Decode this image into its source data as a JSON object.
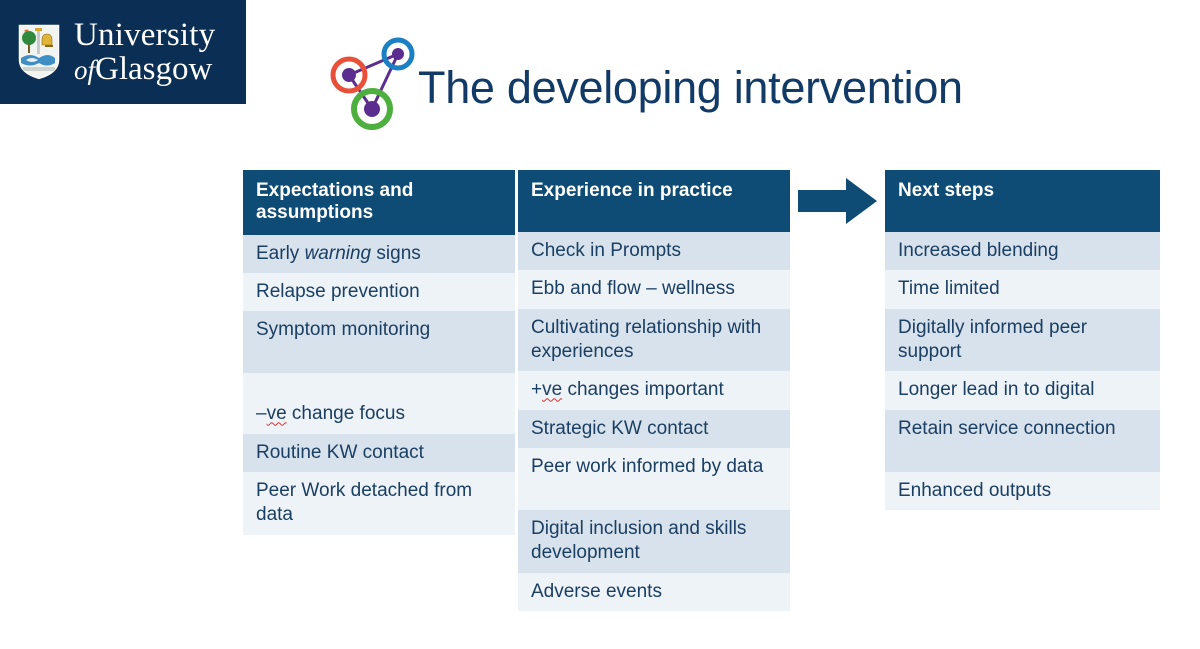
{
  "brand": {
    "logo_line1": "University",
    "logo_of": "of",
    "logo_line2": "Glasgow",
    "crest_icon": "glasgow-coat-of-arms-crest",
    "background_color": "#0a2e54"
  },
  "header": {
    "title": "The developing intervention",
    "title_color": "#123a66",
    "icon": "network-nodes-icon",
    "icon_node_colors": [
      "#e8503a",
      "#1b7fc4",
      "#4caf3e"
    ],
    "icon_center_color": "#5b2d8e",
    "icon_edge_color": "#5b2d8e"
  },
  "flow_arrow": {
    "icon": "arrow-right-icon",
    "color": "#0e4c75"
  },
  "table": {
    "header_bg": "#0e4c75",
    "header_text_color": "#ffffff",
    "row_shade_a": "#d7e2ec",
    "row_shade_b": "#eef3f8",
    "cell_text_color": "#1b3f63",
    "columns": [
      {
        "header": "Expectations and assumptions",
        "rows": [
          {
            "text": "Early warning signs",
            "italic_word": "warning",
            "shade": "a",
            "tall": false
          },
          {
            "text": "Relapse prevention",
            "shade": "b",
            "tall": false
          },
          {
            "text": "Symptom monitoring",
            "shade": "a",
            "tall": true
          },
          {
            "text": "",
            "shade": "b",
            "tall": false,
            "empty": true
          },
          {
            "text": "–ve change focus",
            "misspelled": "ve",
            "shade": "b",
            "tall": false
          },
          {
            "text": "Routine KW contact",
            "shade": "a",
            "tall": false
          },
          {
            "text": "Peer Work detached from data",
            "shade": "b",
            "tall": true
          }
        ]
      },
      {
        "header": "Experience in practice",
        "rows": [
          {
            "text": "Check in Prompts",
            "shade": "a",
            "tall": false
          },
          {
            "text": "Ebb and flow – wellness",
            "shade": "b",
            "tall": false
          },
          {
            "text": "Cultivating relationship with experiences",
            "shade": "a",
            "tall": true
          },
          {
            "text": "+ve changes important",
            "misspelled": "ve",
            "shade": "b",
            "tall": false
          },
          {
            "text": "Strategic KW contact",
            "shade": "a",
            "tall": false
          },
          {
            "text": "Peer work informed by data",
            "shade": "b",
            "tall": true
          },
          {
            "text": "Digital inclusion and skills development",
            "shade": "a",
            "tall": true
          },
          {
            "text": "Adverse events",
            "shade": "b",
            "tall": false
          }
        ]
      },
      {
        "header": "Next steps",
        "rows": [
          {
            "text": "Increased blending",
            "shade": "a",
            "tall": false
          },
          {
            "text": "Time limited",
            "shade": "b",
            "tall": false
          },
          {
            "text": "Digitally informed peer support",
            "shade": "a",
            "tall": true
          },
          {
            "text": "Longer lead in to digital",
            "shade": "b",
            "tall": false
          },
          {
            "text": "Retain service connection",
            "shade": "a",
            "tall": true
          },
          {
            "text": "Enhanced outputs",
            "shade": "b",
            "tall": false
          }
        ]
      }
    ]
  }
}
